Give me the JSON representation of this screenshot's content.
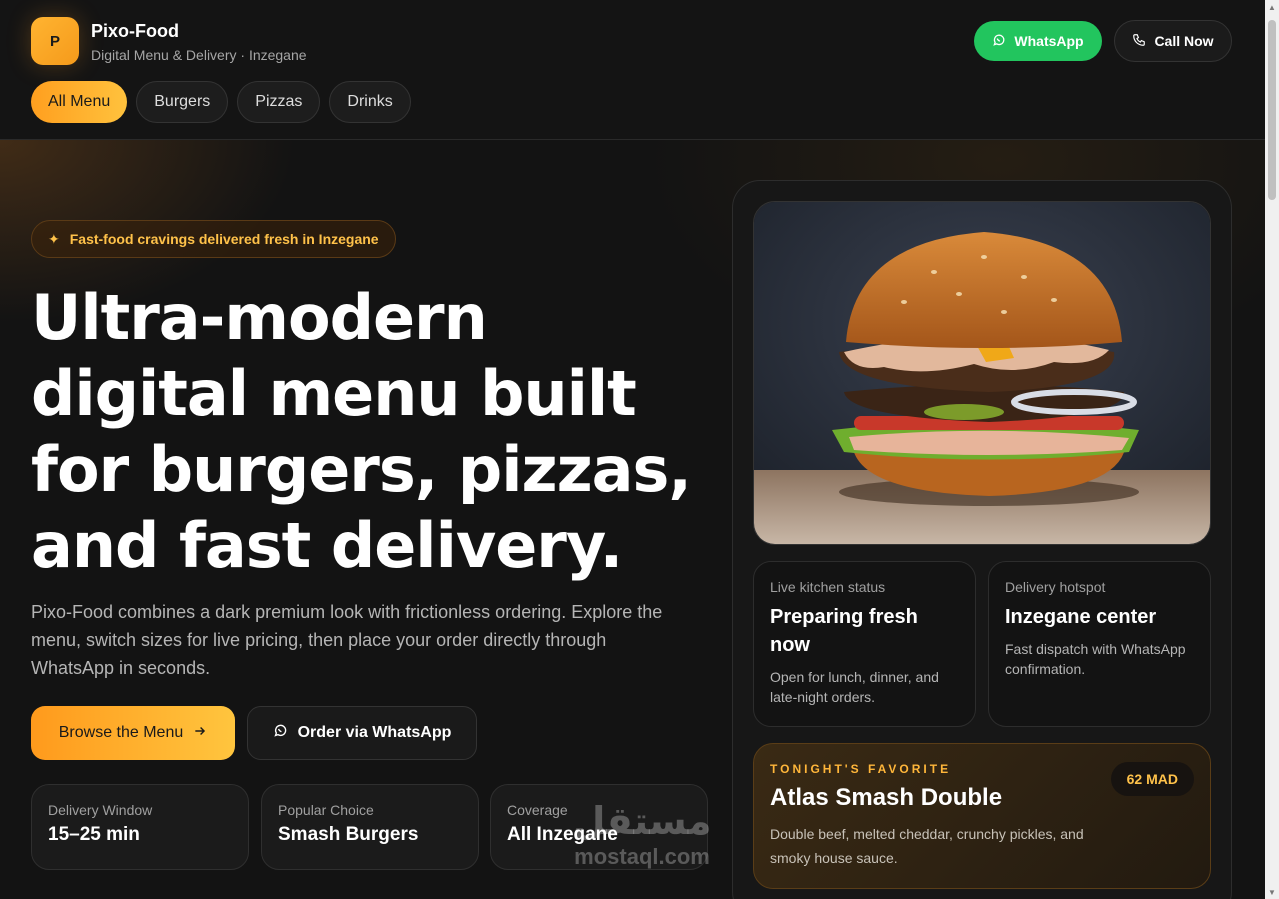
{
  "brand": {
    "logo_letter": "P",
    "name": "Pixo-Food",
    "subtitle": "Digital Menu & Delivery · Inzegane"
  },
  "header_actions": {
    "whatsapp_label": "WhatsApp",
    "call_label": "Call Now"
  },
  "tabs": [
    {
      "label": "All Menu",
      "active": true
    },
    {
      "label": "Burgers",
      "active": false
    },
    {
      "label": "Pizzas",
      "active": false
    },
    {
      "label": "Drinks",
      "active": false
    }
  ],
  "hero": {
    "pill": "Fast-food cravings delivered fresh in Inzegane",
    "headline": "Ultra-modern digital menu built for burgers, pizzas, and fast delivery.",
    "lead": "Pixo-Food combines a dark premium look with frictionless ordering. Explore the menu, switch sizes for live pricing, then place your order directly through WhatsApp in seconds.",
    "browse_label": "Browse the Menu",
    "order_label": "Order via WhatsApp"
  },
  "stats": [
    {
      "label": "Delivery Window",
      "value": "15–25 min"
    },
    {
      "label": "Popular Choice",
      "value": "Smash Burgers"
    },
    {
      "label": "Coverage",
      "value": "All Inzegane"
    }
  ],
  "panel": {
    "kitchen": {
      "label": "Live kitchen status",
      "title": "Preparing fresh now",
      "desc": "Open for lunch, dinner, and late-night orders."
    },
    "hotspot": {
      "label": "Delivery hotspot",
      "title": "Inzegane center",
      "desc": "Fast dispatch with WhatsApp confirmation."
    },
    "favorite": {
      "kicker": "TONIGHT'S FAVORITE",
      "title": "Atlas Smash Double",
      "desc": "Double beef, melted cheddar, crunchy pickles, and smoky house sauce.",
      "price": "62 MAD"
    }
  },
  "watermark": {
    "arabic": "مستقل",
    "latin": "mostaql.com"
  },
  "colors": {
    "accent": "#ffa726",
    "whatsapp": "#22c55e",
    "background": "#131313"
  }
}
